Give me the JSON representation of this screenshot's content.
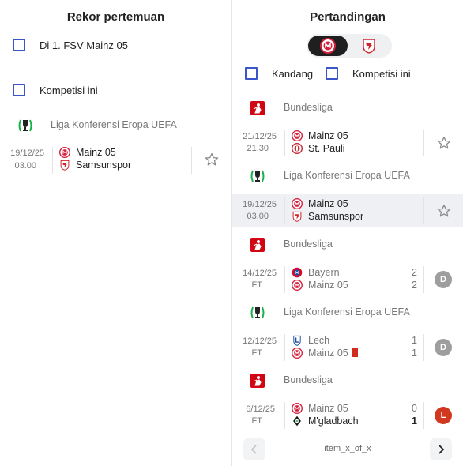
{
  "left": {
    "title": "Rekor pertemuan",
    "filter_team_label": "Di 1. FSV Mainz 05",
    "filter_competition_label": "Kompetisi ini",
    "competition": "Liga Konferensi Eropa UEFA",
    "match": {
      "date": "19/12/25",
      "time": "03.00",
      "home": "Mainz 05",
      "away": "Samsunspor"
    }
  },
  "right": {
    "title": "Pertandingan",
    "filter_home_label": "Kandang",
    "filter_competition_label": "Kompetisi ini",
    "groups": [
      {
        "competition": "Bundesliga",
        "date": "21/12/25",
        "time": "21.30",
        "home": "Mainz 05",
        "away": "St. Pauli"
      },
      {
        "competition": "Liga Konferensi Eropa UEFA",
        "date": "19/12/25",
        "time": "03.00",
        "home": "Mainz 05",
        "away": "Samsunspor"
      },
      {
        "competition": "Bundesliga",
        "date": "14/12/25",
        "time": "FT",
        "home": "Bayern",
        "away": "Mainz 05",
        "home_score": "2",
        "away_score": "2",
        "result": "D"
      },
      {
        "competition": "Liga Konferensi Eropa UEFA",
        "date": "12/12/25",
        "time": "FT",
        "home": "Lech",
        "away": "Mainz 05",
        "home_score": "1",
        "away_score": "1",
        "result": "D"
      },
      {
        "competition": "Bundesliga",
        "date": "6/12/25",
        "time": "FT",
        "home": "Mainz 05",
        "away": "M'gladbach",
        "home_score": "0",
        "away_score": "1",
        "result": "L"
      }
    ],
    "pager_text": "item_x_of_x"
  },
  "colors": {
    "checkbox": "#3a56c8",
    "draw": "#9e9e9e",
    "loss": "#d0391f",
    "mainz_red": "#d4213d",
    "bundesliga_red": "#d20515",
    "uecl_green": "#19b14a",
    "red_card": "#d02b1d"
  },
  "icons": [
    "mainz-crest-icon",
    "samsunspor-crest-icon",
    "bundesliga-icon",
    "uefa-conference-league-icon",
    "star-icon",
    "chevron-left-icon",
    "chevron-right-icon",
    "red-card-icon"
  ]
}
